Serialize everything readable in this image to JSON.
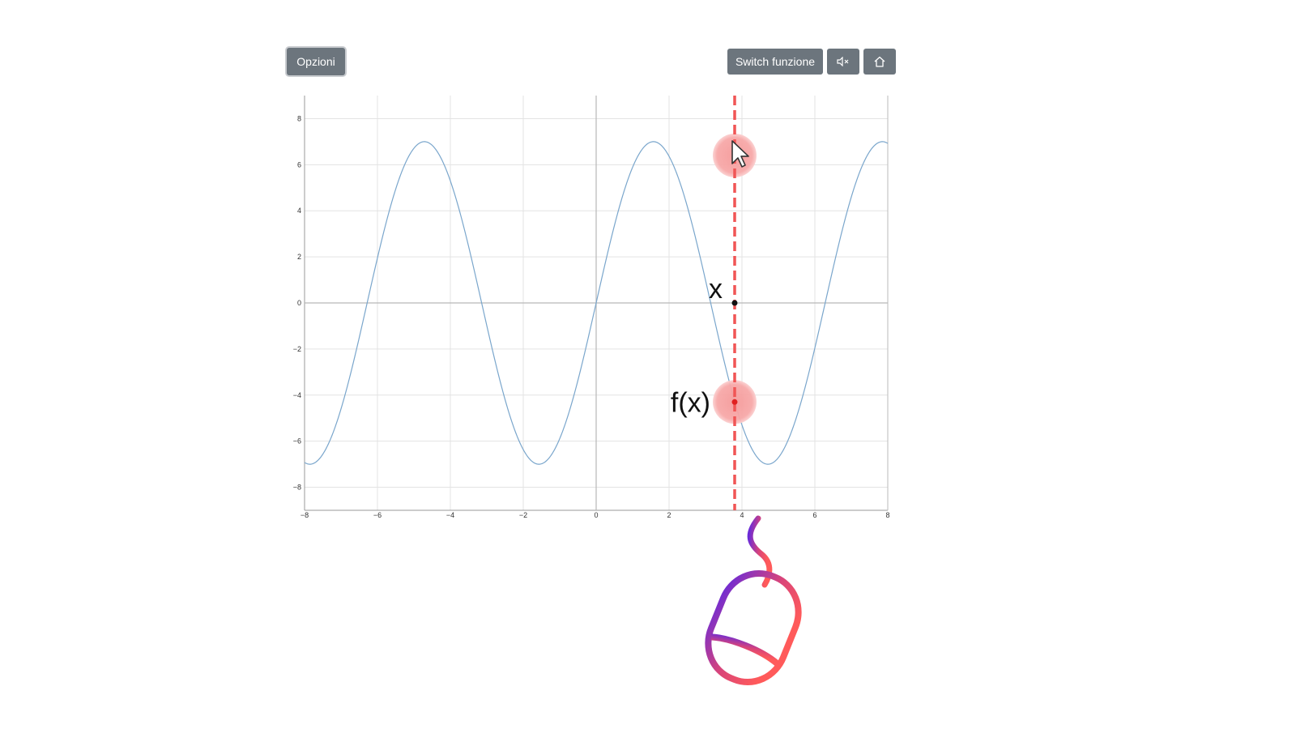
{
  "toolbar": {
    "options_label": "Opzioni",
    "switch_label": "Switch funzione",
    "mute_icon": "speaker-muted-icon",
    "home_icon": "home-icon"
  },
  "annotations": {
    "x_label": "x",
    "fx_label": "f(x)",
    "cursor_icon": "pointer-cursor-icon",
    "mouse_icon": "mouse-icon"
  },
  "colors": {
    "curve": "#7aa6cc",
    "marker_line": "#f05555",
    "highlight": "#f7a8a8",
    "button_bg": "#6c757d",
    "mouse_gradient_start": "#6a2bd8",
    "mouse_gradient_end": "#ff5a5a"
  },
  "chart_data": {
    "type": "line",
    "xlim": [
      -8,
      8
    ],
    "ylim": [
      -9,
      9
    ],
    "x_ticks": [
      -8,
      -6,
      -4,
      -2,
      0,
      2,
      4,
      6,
      8
    ],
    "y_ticks": [
      8,
      6,
      4,
      2,
      0,
      -2,
      -4,
      -6,
      -8
    ],
    "grid": true,
    "function": "7*sin(x)",
    "amplitude": 7,
    "series": [
      {
        "x": [
          -8,
          -7,
          -6,
          -5,
          -4,
          -3,
          -2,
          -1,
          0,
          1,
          2,
          3,
          4,
          5,
          6,
          7,
          8
        ],
        "y": [
          -6.93,
          -4.6,
          1.96,
          6.71,
          5.3,
          -0.99,
          -6.37,
          -5.89,
          0,
          5.89,
          6.37,
          0.99,
          -5.3,
          -6.71,
          -1.96,
          4.6,
          6.93
        ]
      }
    ],
    "selected_x": 3.8,
    "selected_y": -4.3
  }
}
